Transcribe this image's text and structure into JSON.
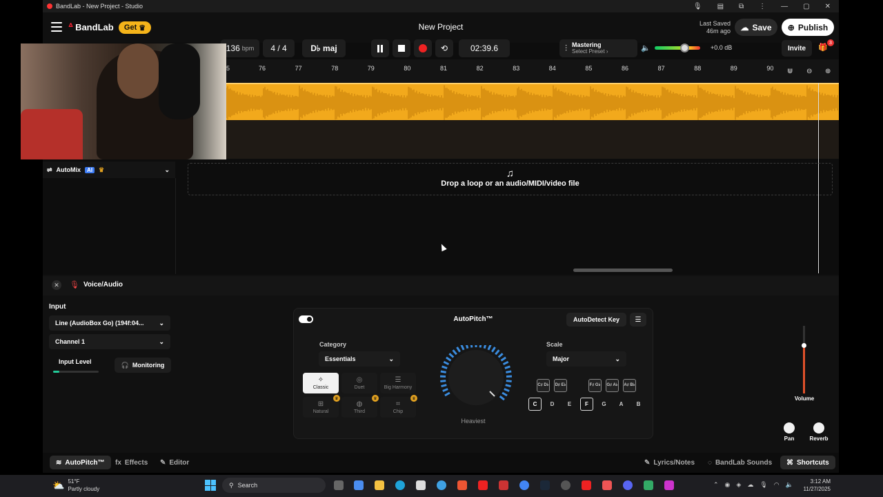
{
  "window": {
    "title": "BandLab - New Project - Studio",
    "controls": {
      "minimize": "—",
      "maximize": "▢",
      "close": "✕"
    }
  },
  "header": {
    "logo_text": "BandLab",
    "get_label": "Get",
    "project_title": "New Project",
    "last_saved_label": "Last Saved",
    "last_saved_value": "46m ago",
    "save_label": "Save",
    "publish_label": "Publish"
  },
  "transport": {
    "bpm_value": "136",
    "bpm_unit": "bpm",
    "time_signature": "4 / 4",
    "key": "D♭ maj",
    "time": "02:39.6",
    "mastering_label": "Mastering",
    "mastering_preset": "Select Preset ›",
    "master_volume_db": "+0.0 dB",
    "master_volume_level": 0.65,
    "invite_label": "Invite",
    "gift_badge": "3"
  },
  "ruler": {
    "bars": [
      "5",
      "76",
      "77",
      "78",
      "79",
      "80",
      "81",
      "82",
      "83",
      "84",
      "85",
      "86",
      "87",
      "88",
      "89",
      "90"
    ]
  },
  "automix": {
    "label": "AutoMix",
    "ai_badge": "AI"
  },
  "drop_zone": {
    "text": "Drop a loop or an audio/MIDI/video file"
  },
  "panel": {
    "title": "Voice/Audio",
    "input_label": "Input",
    "input_device": "Line (AudioBox Go) (194f:04...",
    "channel": "Channel 1",
    "input_level_label": "Input Level",
    "input_level": 0.14,
    "monitoring_label": "Monitoring"
  },
  "autopitch": {
    "title": "AutoPitch™",
    "autodetect_label": "AutoDetect Key",
    "category_label": "Category",
    "category_value": "Essentials",
    "scale_label": "Scale",
    "scale_value": "Major",
    "presets": [
      {
        "label": "Classic",
        "icon": "✧",
        "selected": true,
        "premium": false
      },
      {
        "label": "Duet",
        "icon": "◎",
        "selected": false,
        "premium": false
      },
      {
        "label": "Big Harmony",
        "icon": "☰",
        "selected": false,
        "premium": false
      },
      {
        "label": "Natural",
        "icon": "⊞",
        "selected": false,
        "premium": true
      },
      {
        "label": "Third",
        "icon": "◍",
        "selected": false,
        "premium": true
      },
      {
        "label": "Chip",
        "icon": "⌗",
        "selected": false,
        "premium": true
      }
    ],
    "knob_label": "Heaviest",
    "sharp_notes": [
      "C♯ D♭",
      "D♯ E♭",
      "F♯ G♭",
      "G♯ A♭",
      "A♯ B♭"
    ],
    "natural_notes": [
      "C",
      "D",
      "E",
      "F",
      "G",
      "A",
      "B"
    ],
    "active_notes": [
      "C",
      "F"
    ]
  },
  "mixer": {
    "volume_label": "Volume",
    "pan_label": "Pan",
    "reverb_label": "Reverb"
  },
  "bottom_tabs": {
    "autopitch": "AutoPitch™",
    "effects": "Effects",
    "editor": "Editor",
    "lyrics": "Lyrics/Notes",
    "sounds": "BandLab Sounds",
    "shortcuts": "Shortcuts"
  },
  "taskbar": {
    "weather_temp": "51°F",
    "weather_desc": "Partly cloudy",
    "search_placeholder": "Search",
    "time": "3:12 AM",
    "date": "11/27/2025"
  },
  "colors": {
    "accent_orange": "#f2a91c",
    "record_red": "#e22",
    "premium_gold": "#e0a020",
    "ai_blue": "#3d7cf4"
  }
}
